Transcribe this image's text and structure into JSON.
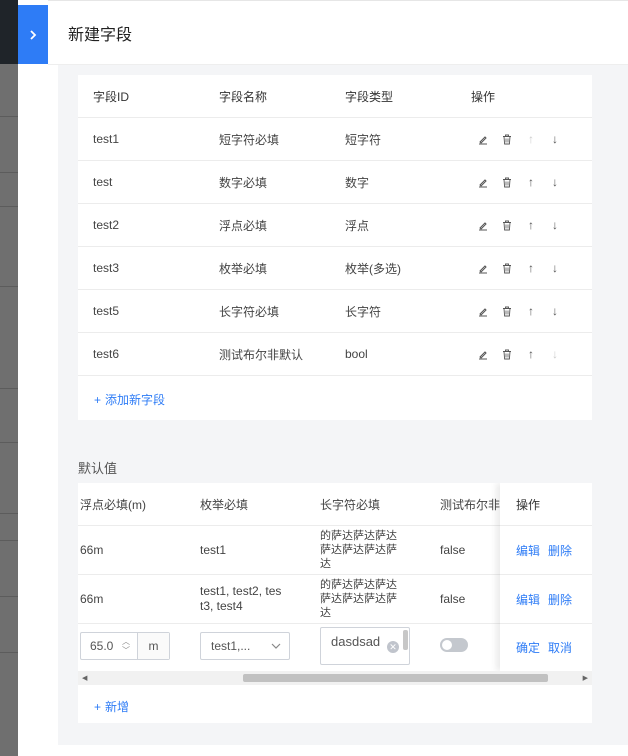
{
  "drawer": {
    "title": "新建字段"
  },
  "fields_table": {
    "headers": [
      "字段ID",
      "字段名称",
      "字段类型",
      "操作"
    ],
    "rows": [
      {
        "id": "test1",
        "name": "短字符必填",
        "type": "短字符",
        "up_disabled": true,
        "down_disabled": false
      },
      {
        "id": "test",
        "name": "数字必填",
        "type": "数字",
        "up_disabled": false,
        "down_disabled": false
      },
      {
        "id": "test2",
        "name": "浮点必填",
        "type": "浮点",
        "up_disabled": false,
        "down_disabled": false
      },
      {
        "id": "test3",
        "name": "枚举必填",
        "type": "枚举(多选)",
        "up_disabled": false,
        "down_disabled": false
      },
      {
        "id": "test5",
        "name": "长字符必填",
        "type": "长字符",
        "up_disabled": false,
        "down_disabled": false
      },
      {
        "id": "test6",
        "name": "测试布尔非默认",
        "type": "bool",
        "up_disabled": false,
        "down_disabled": true
      }
    ],
    "add_label": "添加新字段"
  },
  "defaults": {
    "section_label": "默认值",
    "headers": [
      "浮点必填(m)",
      "枚举必填",
      "长字符必填",
      "测试布尔非",
      "操作"
    ],
    "rows": [
      {
        "float": "66m",
        "enum": "test1",
        "long_lines": [
          "的萨达萨达萨达",
          "萨达萨达萨达萨",
          "达"
        ],
        "bool": "false",
        "edit": "编辑",
        "delete": "删除"
      },
      {
        "float": "66m",
        "enum_lines": [
          "test1, test2, tes",
          "t3, test4"
        ],
        "long_lines": [
          "的萨达萨达萨达",
          "萨达萨达萨达萨",
          "达"
        ],
        "bool": "false",
        "edit": "编辑",
        "delete": "删除"
      }
    ],
    "edit_row": {
      "float_value": "65.0",
      "unit": "m",
      "enum_value": "test1,...",
      "long_value": "dasdsad",
      "bool_on": false,
      "confirm": "确定",
      "cancel": "取消"
    },
    "add_label": "新增"
  }
}
